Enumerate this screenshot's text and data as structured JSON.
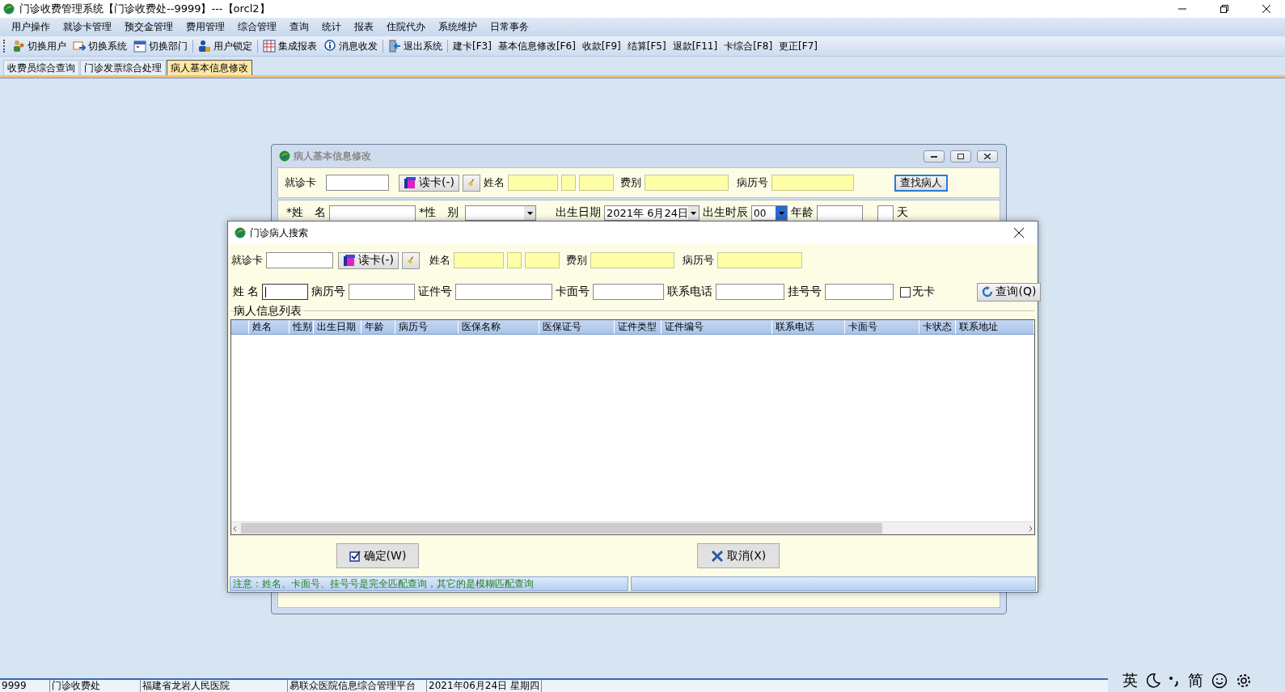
{
  "window": {
    "title": "门诊收费管理系统【门诊收费处--9999】---【orcl2】"
  },
  "menu": [
    "用户操作",
    "就诊卡管理",
    "预交金管理",
    "费用管理",
    "综合管理",
    "查询",
    "统计",
    "报表",
    "住院代办",
    "系统维护",
    "日常事务"
  ],
  "toolbar": [
    {
      "kind": "icon",
      "label": "切换用户"
    },
    {
      "kind": "icon",
      "label": "切换系统"
    },
    {
      "kind": "icon",
      "label": "切换部门"
    },
    {
      "kind": "icon",
      "label": "用户锁定"
    },
    {
      "kind": "icon",
      "label": "集成报表"
    },
    {
      "kind": "icon",
      "label": "消息收发"
    },
    {
      "kind": "icon",
      "label": "退出系统"
    },
    {
      "kind": "text",
      "label": "建卡[F3]"
    },
    {
      "kind": "text",
      "label": "基本信息修改[F6]"
    },
    {
      "kind": "text",
      "label": "收款[F9]"
    },
    {
      "kind": "text",
      "label": "结算[F5]"
    },
    {
      "kind": "text",
      "label": "退款[F11]"
    },
    {
      "kind": "text",
      "label": "卡综合[F8]"
    },
    {
      "kind": "text",
      "label": "更正[F7]"
    }
  ],
  "tabs": [
    {
      "label": "收费员综合查询",
      "selected": false
    },
    {
      "label": "门诊发票综合处理",
      "selected": false
    },
    {
      "label": "病人基本信息修改",
      "selected": true
    }
  ],
  "edit_dialog": {
    "title": "病人基本信息修改",
    "card_label": "就诊卡",
    "read_card": "读卡(-)",
    "name_label": "姓名",
    "fee_label": "费别",
    "record_label": "病历号",
    "find_button": "查找病人",
    "name2_label": "*姓　名",
    "sex_label": "*性　别",
    "birth_label": "出生日期",
    "birth_value": "2021年  6月24日",
    "hour_label": "出生时辰",
    "hour_value": "00",
    "age_label": "年龄",
    "day_label": "天"
  },
  "search_dialog": {
    "title": "门诊病人搜索",
    "card_label": "就诊卡",
    "read_card": "读卡(-)",
    "name_label": "姓名",
    "fee_label": "费别",
    "record_label": "病历号",
    "filters": [
      {
        "label": "姓 名",
        "focused": true
      },
      {
        "label": "病历号",
        "focused": false
      },
      {
        "label": "证件号",
        "focused": false
      },
      {
        "label": "卡面号",
        "focused": false
      },
      {
        "label": "联系电话",
        "focused": false
      },
      {
        "label": "挂号号",
        "focused": false
      }
    ],
    "no_card": {
      "label": "无卡",
      "checked": false
    },
    "query_button": "查询(Q)",
    "group_title": "病人信息列表",
    "columns": [
      "姓名",
      "性别",
      "出生日期",
      "年龄",
      "病历号",
      "医保名称",
      "医保证号",
      "证件类型",
      "证件编号",
      "联系电话",
      "卡面号",
      "卡状态",
      "联系地址"
    ],
    "ok_button": "确定(W)",
    "cancel_button": "取消(X)",
    "note": "注意：姓名、卡面号、挂号号是完全匹配查询，其它的是模糊匹配查询"
  },
  "status_bar": [
    "9999",
    "门诊收费处",
    "福建省龙岩人民医院",
    "易联众医院信息综合管理平台",
    "2021年06月24日 星期四"
  ],
  "ime": {
    "language": "英",
    "charset": "简"
  }
}
